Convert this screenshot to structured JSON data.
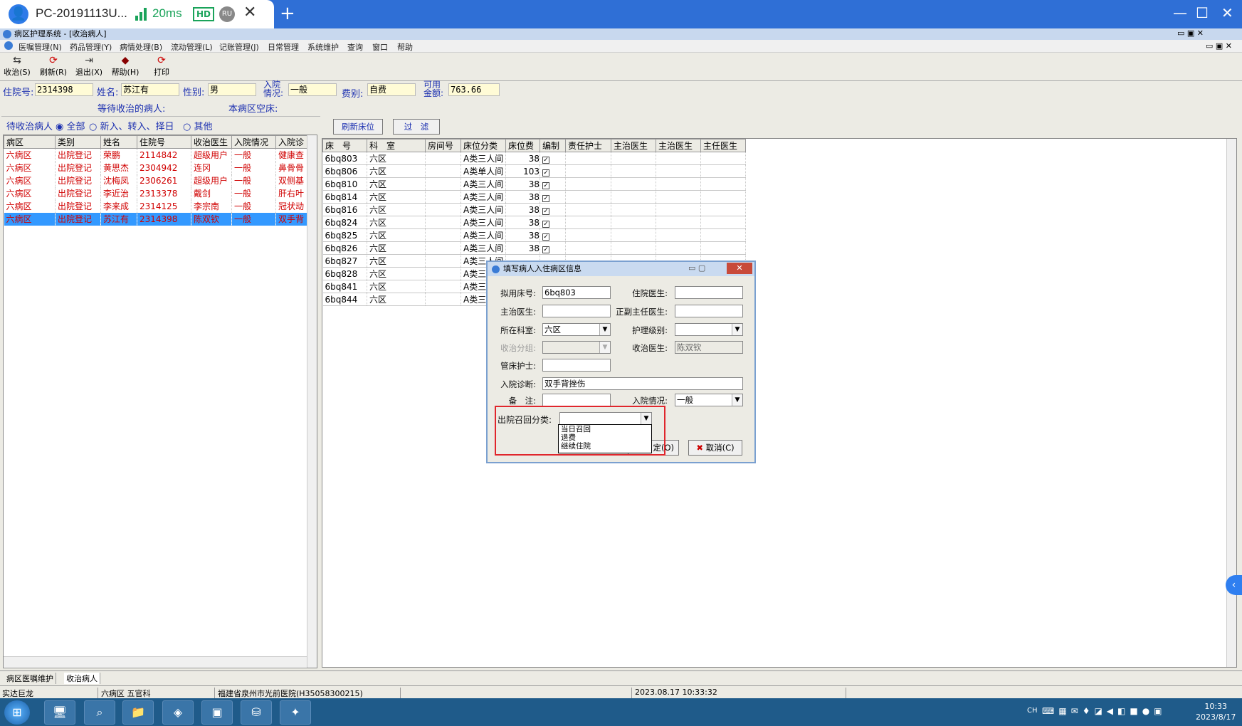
{
  "remote": {
    "title": "PC-20191113U...",
    "ping": "20ms",
    "hd": "HD",
    "lang": "RU",
    "close": "✕",
    "plus": "+",
    "win_min": "—",
    "win_max": "☐",
    "win_close": "✕"
  },
  "app": {
    "title": "病区护理系统 - [收治病人]"
  },
  "menu": [
    "医嘱管理(N)",
    "药品管理(Y)",
    "病情处理(B)",
    "流动管理(L)",
    "记账管理(J)",
    "日常管理",
    "系统维护",
    "查询",
    "窗口",
    "帮助"
  ],
  "toolbar": [
    {
      "label": "收治(S)",
      "icon": "admit-icon"
    },
    {
      "label": "刷新(R)",
      "icon": "refresh-icon"
    },
    {
      "label": "退出(X)",
      "icon": "exit-icon"
    },
    {
      "label": "帮助(H)",
      "icon": "help-icon"
    },
    {
      "label": "打印",
      "icon": "print-icon"
    }
  ],
  "patient": {
    "inpatient_no_label": "住院号:",
    "inpatient_no": "2314398",
    "name_label": "姓名:",
    "name": "苏江有",
    "gender_label": "性别:",
    "gender": "男",
    "admit_cond_label1": "入院",
    "admit_cond_label2": "情况:",
    "admit_cond": "一般",
    "fee_label": "费别:",
    "fee": "自费",
    "balance_label1": "可用",
    "balance_label2": "金额:",
    "balance": "763.66",
    "waiting_label": "等待收治的病人:",
    "empty_beds_label": "本病区空床:"
  },
  "filter": {
    "label": "待收治病人",
    "opt_all": "全部",
    "opt_new": "新入、转入、择日",
    "opt_other": "其他"
  },
  "buttons": {
    "refresh_beds": "刷新床位",
    "filter": "过　滤"
  },
  "left_grid": {
    "headers": [
      "病区",
      "类别",
      "姓名",
      "住院号",
      "收治医生",
      "入院情况",
      "入院诊"
    ],
    "rows": [
      [
        "六病区",
        "出院登记",
        "荣鹏",
        "2114842",
        "超级用户",
        "一般",
        "健康查"
      ],
      [
        "六病区",
        "出院登记",
        "黄思杰",
        "2304942",
        "连冈",
        "一般",
        "鼻骨骨"
      ],
      [
        "六病区",
        "出院登记",
        "沈梅凤",
        "2306261",
        "超级用户",
        "一般",
        "双侧基"
      ],
      [
        "六病区",
        "出院登记",
        "李近治",
        "2313378",
        "戴剑",
        "一般",
        "肝右叶"
      ],
      [
        "六病区",
        "出院登记",
        "李来成",
        "2314125",
        "李宗南",
        "一般",
        "冠状动"
      ],
      [
        "六病区",
        "出院登记",
        "苏江有",
        "2314398",
        "陈双钦",
        "一般",
        "双手背"
      ]
    ]
  },
  "right_grid": {
    "headers": [
      "床　号",
      "科　室",
      "房间号",
      "床位分类",
      "床位费",
      "编制",
      "责任护士",
      "主治医生",
      "主治医生",
      "主任医生"
    ],
    "rows": [
      [
        "6bq803",
        "六区",
        "",
        "A类三人间",
        "38",
        "✓"
      ],
      [
        "6bq806",
        "六区",
        "",
        "A类单人间",
        "103",
        "✓"
      ],
      [
        "6bq810",
        "六区",
        "",
        "A类三人间",
        "38",
        "✓"
      ],
      [
        "6bq814",
        "六区",
        "",
        "A类三人间",
        "38",
        "✓"
      ],
      [
        "6bq816",
        "六区",
        "",
        "A类三人间",
        "38",
        "✓"
      ],
      [
        "6bq824",
        "六区",
        "",
        "A类三人间",
        "38",
        "✓"
      ],
      [
        "6bq825",
        "六区",
        "",
        "A类三人间",
        "38",
        "✓"
      ],
      [
        "6bq826",
        "六区",
        "",
        "A类三人间",
        "38",
        "✓"
      ],
      [
        "6bq827",
        "六区",
        "",
        "A类三人间",
        "",
        ""
      ],
      [
        "6bq828",
        "六区",
        "",
        "A类三",
        "",
        ""
      ],
      [
        "6bq841",
        "六区",
        "",
        "A类三",
        "",
        ""
      ],
      [
        "6bq844",
        "六区",
        "",
        "A类三",
        "",
        ""
      ]
    ]
  },
  "dialog": {
    "title": "填写病人入住病区信息",
    "bed_label": "拟用床号:",
    "bed": "6bq803",
    "resident_label": "住院医生:",
    "resident": "",
    "attending_label": "主治医生:",
    "attending": "",
    "chief_label": "正副主任医生:",
    "chief": "",
    "dept_label": "所在科室:",
    "dept": "六区",
    "nursing_label": "护理级别:",
    "nursing": "",
    "group_label": "收治分组:",
    "group": "",
    "admit_doc_label": "收治医生:",
    "admit_doc": "陈双钦",
    "nurse_label": "管床护士:",
    "nurse": "",
    "diag_label": "入院诊断:",
    "diag": "双手背挫伤",
    "note_label": "备　注:",
    "note": "",
    "cond_label": "入院情况:",
    "cond": "一般",
    "recall_label": "出院召回分类:",
    "recall": "",
    "recall_options": [
      "当日召回",
      "退费",
      "继续住院"
    ],
    "ok": "定(O)",
    "cancel": "取消(C)"
  },
  "bottom_tabs": [
    "病区医嘱维护",
    "收治病人"
  ],
  "status": {
    "user": "实达巨龙",
    "ward": "六病区 五官科",
    "hospital": "福建省泉州市光前医院(H35058300215)",
    "datetime": "2023.08.17 10:33:32"
  },
  "taskbar": {
    "lang": "CH",
    "time": "10:33",
    "date": "2023/8/17"
  },
  "colors": {
    "rd_blue": "#2f6fd6",
    "selection": "#3399ff",
    "record_red": "#d00000",
    "label_blue": "#1b2fb0",
    "highlight_box": "#e0262c"
  }
}
